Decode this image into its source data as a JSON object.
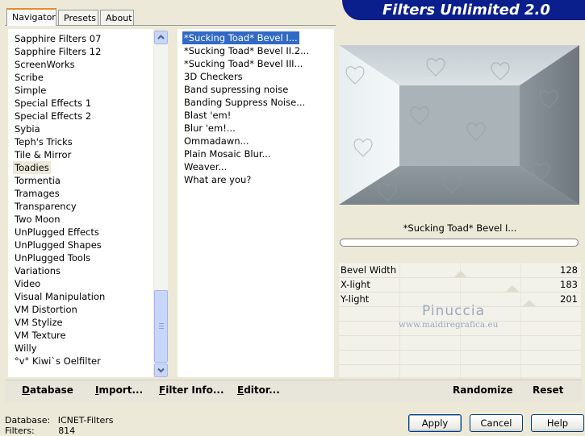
{
  "tabs": [
    "Navigator",
    "Presets",
    "About"
  ],
  "app_title": "Filters Unlimited 2.0",
  "categories": [
    "Sapphire Filters 07",
    "Sapphire Filters 12",
    "ScreenWorks",
    "Scribe",
    "Simple",
    "Special Effects 1",
    "Special Effects 2",
    "Sybia",
    "Teph's Tricks",
    "Tile & Mirror",
    "Toadies",
    "Tormentia",
    "Tramages",
    "Transparency",
    "Two Moon",
    "UnPlugged Effects",
    "UnPlugged Shapes",
    "UnPlugged Tools",
    "Variations",
    "Video",
    "Visual Manipulation",
    "VM Distortion",
    "VM Stylize",
    "VM Texture",
    "Willy",
    "°v° Kiwi`s Oelfilter"
  ],
  "selected_category": "Toadies",
  "filters": [
    "*Sucking Toad*  Bevel I...",
    "*Sucking Toad*  Bevel II.2...",
    "*Sucking Toad*  Bevel III...",
    "3D Checkers",
    "Band supressing noise",
    "Banding Suppress Noise...",
    "Blast 'em!",
    "Blur 'em!...",
    "Ommadawn...",
    "Plain Mosaic Blur...",
    "Weaver...",
    "What are you?"
  ],
  "selected_filter": "*Sucking Toad*  Bevel I...",
  "current_filter_name": "*Sucking Toad*  Bevel I...",
  "params": [
    {
      "label": "Bevel Width",
      "value": "128",
      "fraction": 0.502
    },
    {
      "label": "X-light",
      "value": "183",
      "fraction": 0.718
    },
    {
      "label": "Y-light",
      "value": "201",
      "fraction": 0.788
    }
  ],
  "watermark": {
    "title": "Pinuccia",
    "url": "www.maidiregrafica.eu"
  },
  "toolbar": {
    "database": "Database",
    "import": "Import...",
    "filter_info": "Filter Info...",
    "editor": "Editor...",
    "randomize": "Randomize",
    "reset": "Reset"
  },
  "status": {
    "database_label": "Database:",
    "database_value": "ICNET-Filters",
    "filters_label": "Filters:",
    "filters_value": "814"
  },
  "buttons": {
    "apply": "Apply",
    "cancel": "Cancel",
    "help": "Help"
  },
  "colors": {
    "banner": "#0A1E8C",
    "selection": "#316AC5",
    "window": "#ECE9D8"
  }
}
